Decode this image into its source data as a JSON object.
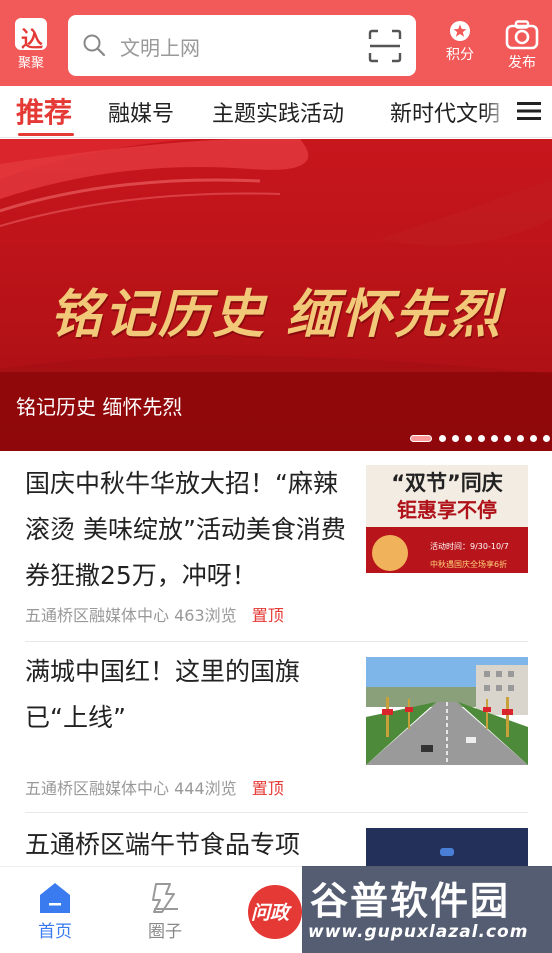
{
  "header": {
    "logo_label": "聚聚",
    "search_placeholder": "文明上网",
    "points_label": "积分",
    "publish_label": "发布"
  },
  "tabs": [
    {
      "label": "推荐",
      "active": true
    },
    {
      "label": "融媒号"
    },
    {
      "label": "主题实践活动"
    },
    {
      "label": "新时代文明"
    }
  ],
  "banner": {
    "title": "铭记历史 缅怀先烈",
    "caption": "铭记历史 缅怀先烈",
    "slide_count": 10,
    "active_slide": 1
  },
  "news": [
    {
      "title": "国庆中秋牛华放大招！“麻辣滚烫 美味绽放”活动美食消费券狂撒25万，冲呀！",
      "source": "五通桥区融媒体中心",
      "views": "463浏览",
      "pin": "置顶",
      "thumb": {
        "line1": "“双节”同庆",
        "line2": "钜惠享不停",
        "line3": "活动时间：9/30-10/7",
        "line4": "中秋遇国庆全场享6折"
      }
    },
    {
      "title": "满城中国红！这里的国旗已“上线”",
      "source": "五通桥区融媒体中心",
      "views": "444浏览",
      "pin": "置顶"
    },
    {
      "title": "五通桥区端午节食品专项",
      "source": "",
      "views": "",
      "pin": ""
    }
  ],
  "bottom_nav": [
    {
      "label": "首页",
      "active": true
    },
    {
      "label": "圈子"
    },
    {
      "label": "问政"
    }
  ],
  "watermark": {
    "name": "谷普软件园",
    "url": "www.gupuxlazal.com"
  },
  "colors": {
    "brand": "#f25959",
    "accent": "#e53935",
    "nav_active": "#3a7cf0"
  }
}
